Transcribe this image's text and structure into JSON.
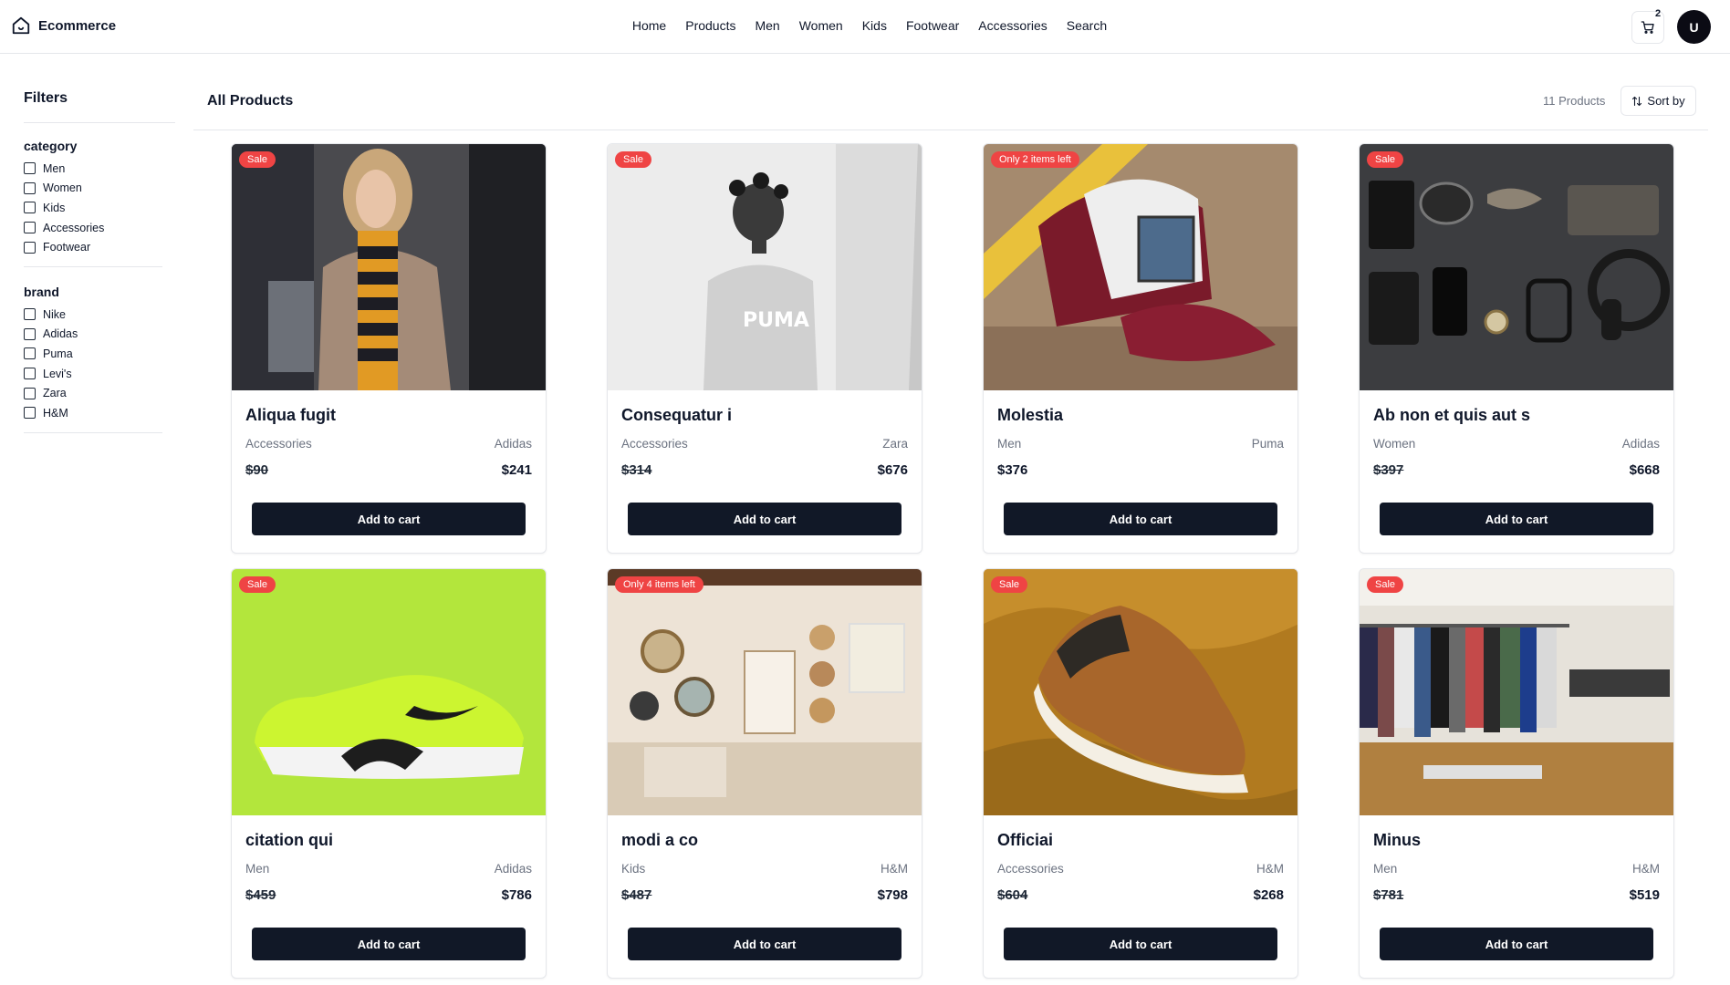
{
  "header": {
    "brand": "Ecommerce",
    "nav": [
      "Home",
      "Products",
      "Men",
      "Women",
      "Kids",
      "Footwear",
      "Accessories",
      "Search"
    ],
    "cart_count": "2",
    "avatar_initial": "U"
  },
  "sidebar": {
    "title": "Filters",
    "groups": [
      {
        "title": "category",
        "options": [
          "Men",
          "Women",
          "Kids",
          "Accessories",
          "Footwear"
        ]
      },
      {
        "title": "brand",
        "options": [
          "Nike",
          "Adidas",
          "Puma",
          "Levi's",
          "Zara",
          "H&M"
        ]
      }
    ]
  },
  "main": {
    "title": "All Products",
    "count_label": "11 Products",
    "sort_label": "Sort by"
  },
  "products": [
    {
      "name": "Aliqua fugit",
      "category": "Accessories",
      "brand": "Adidas",
      "old_price": "$90",
      "price": "$241",
      "badge": "Sale",
      "button": "Add to cart",
      "image": "woman-striped-sweater-street"
    },
    {
      "name": "Consequatur i",
      "category": "Accessories",
      "brand": "Zara",
      "old_price": "$314",
      "price": "$676",
      "badge": "Sale",
      "button": "Add to cart",
      "image": "girl-puma-hoodie-bw"
    },
    {
      "name": "Molestia",
      "category": "Men",
      "brand": "Puma",
      "old_price": "",
      "price": "$376",
      "badge": "Only 2 items left",
      "button": "Add to cart",
      "image": "maroon-trucker-cap"
    },
    {
      "name": "Ab non et quis aut s",
      "category": "Women",
      "brand": "Adidas",
      "old_price": "$397",
      "price": "$668",
      "badge": "Sale",
      "button": "Add to cart",
      "image": "flatlay-accessories"
    },
    {
      "name": "citation qui",
      "category": "Men",
      "brand": "Adidas",
      "old_price": "$459",
      "price": "$786",
      "badge": "Sale",
      "button": "Add to cart",
      "image": "neon-green-sneaker"
    },
    {
      "name": "modi a co",
      "category": "Kids",
      "brand": "H&M",
      "old_price": "$487",
      "price": "$798",
      "badge": "Only 4 items left",
      "button": "Add to cart",
      "image": "boutique-wall-mirrors"
    },
    {
      "name": "Officiai",
      "category": "Accessories",
      "brand": "H&M",
      "old_price": "$604",
      "price": "$268",
      "badge": "Sale",
      "button": "Add to cart",
      "image": "brown-sneaker-mustard-fabric"
    },
    {
      "name": "Minus",
      "category": "Men",
      "brand": "H&M",
      "old_price": "$781",
      "price": "$519",
      "badge": "Sale",
      "button": "Add to cart",
      "image": "clothing-store-racks"
    }
  ],
  "colors": {
    "accent": "#111827",
    "badge": "#ef4444",
    "muted": "#6b7280"
  }
}
